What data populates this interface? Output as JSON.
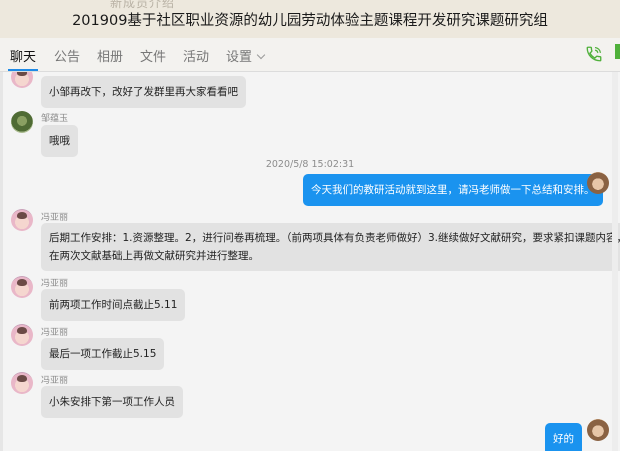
{
  "window": {
    "title": "201909基于社区职业资源的幼儿园劳动体验主题课程开发研究课题研究组",
    "ghost_title": "新成员介绍"
  },
  "tabs": [
    "聊天",
    "公告",
    "相册",
    "文件",
    "活动",
    "设置"
  ],
  "chat": {
    "timestamp": "2020/5/8 15:02:31",
    "messages": [
      {
        "sender": "",
        "text": "小邹再改下，改好了发群里再大家看看吧"
      },
      {
        "sender": "邹蕴玉",
        "text": "哦哦"
      },
      {
        "sender": "me",
        "text": "今天我们的教研活动就到这里，请冯老师做一下总结和安排。"
      },
      {
        "sender": "冯亚丽",
        "line1": "后期工作安排：1.资源整理。2，进行问卷再梳理。（前两项具体有负责老师做好）3.继续做好文献研究，要求紧扣课题内容，",
        "line2": "在两次文献基础上再做文献研究并进行整理。"
      },
      {
        "sender": "冯亚丽",
        "text": "前两项工作时间点截止5.11"
      },
      {
        "sender": "冯亚丽",
        "text": "最后一项工作截止5.15"
      },
      {
        "sender": "冯亚丽",
        "text": "小朱安排下第一项工作人员"
      },
      {
        "sender": "me",
        "text": "好的"
      }
    ]
  },
  "colors": {
    "accent": "#1e8ae6",
    "my_bubble": "#1a93ef",
    "other_bubble": "#e2e2e2",
    "call_icon": "#4fb03a"
  },
  "icons": {
    "call": "phone-icon",
    "settings_menu": "chevron-down-icon"
  }
}
